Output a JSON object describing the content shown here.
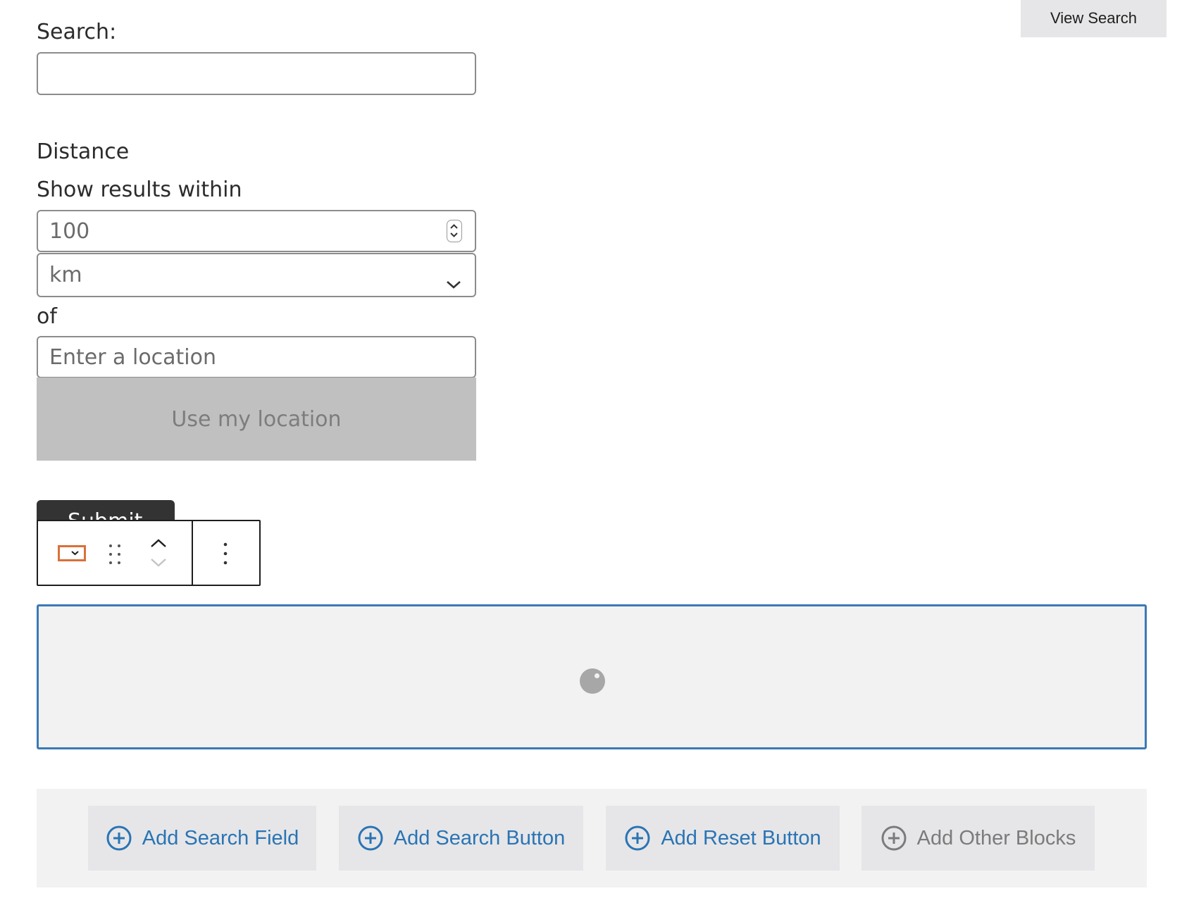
{
  "header": {
    "view_search_label": "View Search"
  },
  "search": {
    "label": "Search:",
    "value": "",
    "placeholder": ""
  },
  "distance": {
    "heading": "Distance",
    "show_results_label": "Show results within",
    "radius_value": "100",
    "unit_selected": "km",
    "of_label": "of",
    "location_placeholder": "Enter a location",
    "use_my_location_label": "Use my location"
  },
  "submit": {
    "label": "Submit"
  },
  "block_toolbar": {
    "icons": [
      "select-block-icon",
      "drag-handle-icon",
      "move-up-icon",
      "move-down-icon",
      "more-options-icon"
    ]
  },
  "add_bar": {
    "buttons": [
      {
        "label": "Add Search Field"
      },
      {
        "label": "Add Search Button"
      },
      {
        "label": "Add Reset Button"
      },
      {
        "label": "Add Other Blocks"
      }
    ]
  },
  "colors": {
    "accent": "#2a74b4",
    "selection_border": "#3a7ab5",
    "block_icon": "#d9703a",
    "disabled_button": "#c0c0c0"
  }
}
